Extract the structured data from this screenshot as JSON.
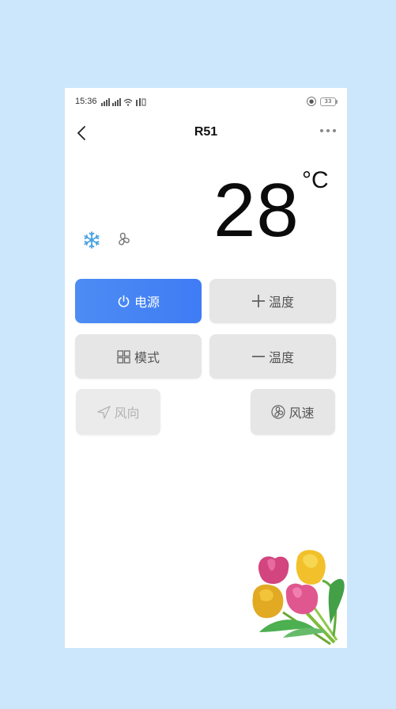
{
  "status_bar": {
    "time": "15:36",
    "signal_icons": [
      "signal-sim1-icon",
      "signal-sim2-icon",
      "wifi-icon",
      "data-icon"
    ],
    "battery_level": "33",
    "lock_icon": "rotation-lock-icon"
  },
  "navbar": {
    "title": "R51",
    "back_icon": "chevron-left-icon",
    "more_icon": "more-horizontal-icon"
  },
  "display": {
    "temperature": "28",
    "unit": "°C",
    "mode_icon": "snowflake-icon",
    "fan_icon": "fan-icon",
    "mode_color": "#4aa3e0"
  },
  "buttons": {
    "power": {
      "label": "电源",
      "icon": "power-icon",
      "active": true,
      "color": "#4585f4"
    },
    "temp_up": {
      "label": "温度",
      "icon": "plus-icon"
    },
    "mode": {
      "label": "模式",
      "icon": "grid-icon"
    },
    "temp_down": {
      "label": "温度",
      "icon": "minus-icon"
    },
    "direction": {
      "label": "风向",
      "icon": "navigation-arrow-icon",
      "disabled": true
    },
    "speed": {
      "label": "风速",
      "icon": "fan-speed-icon"
    }
  },
  "decoration": {
    "image": "tulip-bouquet"
  }
}
